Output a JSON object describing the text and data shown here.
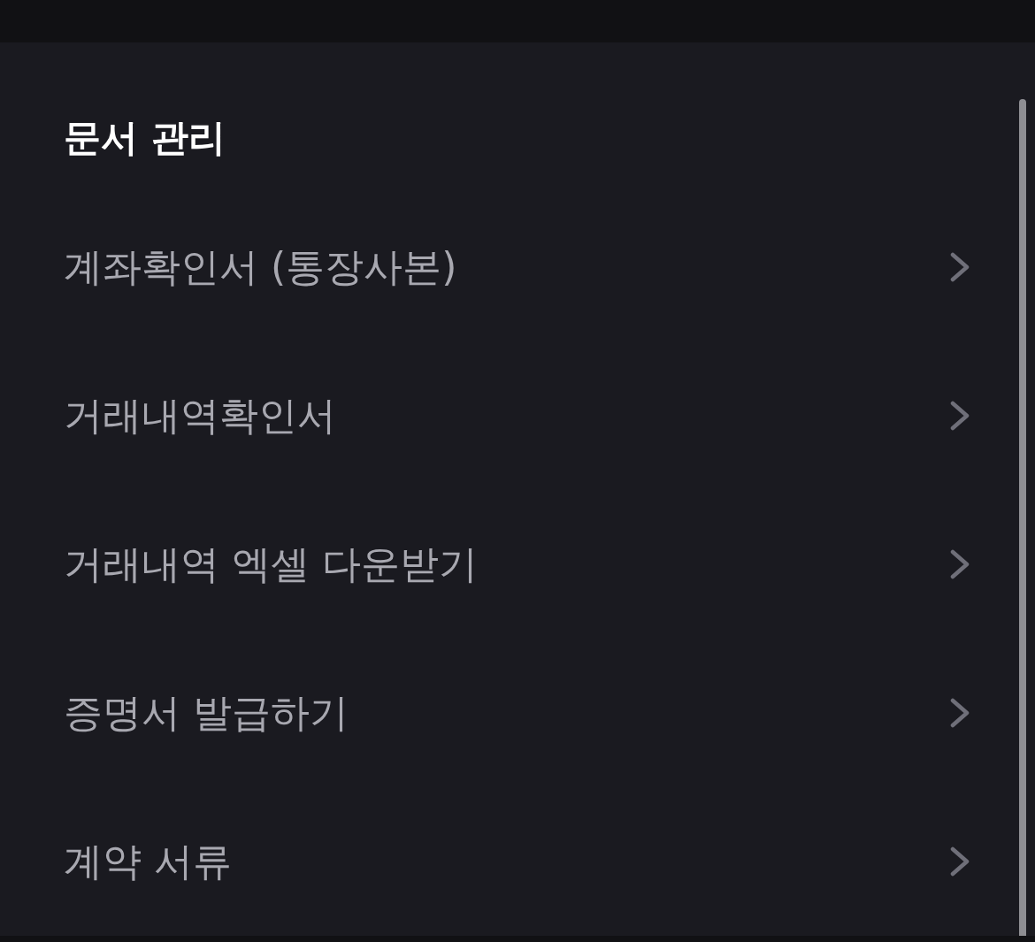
{
  "header": {
    "title": "문서 관리"
  },
  "menu": {
    "items": [
      {
        "label": "계좌확인서 (통장사본)"
      },
      {
        "label": "거래내역확인서"
      },
      {
        "label": "거래내역 엑셀 다운받기"
      },
      {
        "label": "증명서 발급하기"
      },
      {
        "label": "계약 서류"
      }
    ]
  }
}
